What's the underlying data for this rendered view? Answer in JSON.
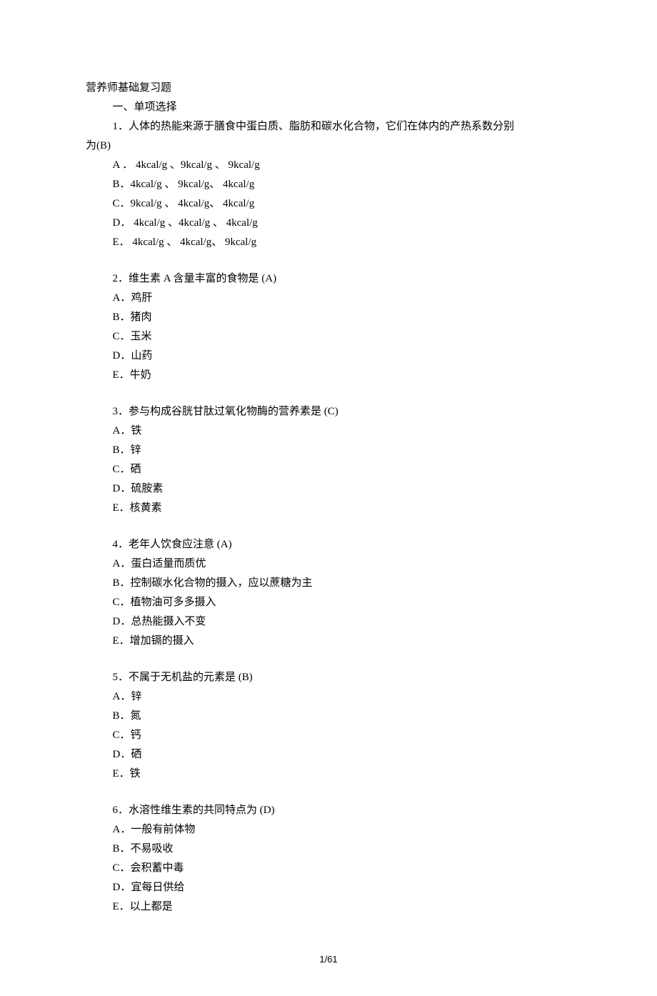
{
  "title": "营养师基础复习题",
  "section": "一、单项选择",
  "q1": {
    "stem1": "1．人体的热能来源于膳食中蛋白质、脂肪和碳水化合物，它们在体内的产热系数分别",
    "stem2wrap": "为(B)",
    "A": "A ． 4kcal/g 、9kcal/g 、 9kcal/g",
    "B": "B．4kcal/g 、 9kcal/g、 4kcal/g",
    "C": "C．9kcal/g 、 4kcal/g、 4kcal/g",
    "D": "D． 4kcal/g 、4kcal/g 、 4kcal/g",
    "E": "E． 4kcal/g 、 4kcal/g、 9kcal/g"
  },
  "q2": {
    "stem": "2．维生素  A 含量丰富的食物是    (A)",
    "A": "A．鸡肝",
    "B": "B．猪肉",
    "C": "C．玉米",
    "D": "D．山药",
    "E": "E．牛奶"
  },
  "q3": {
    "stem": "3．参与构成谷胱甘肽过氧化物酶的营养素是      (C)",
    "A": "A．铁",
    "B": "B．锌",
    "C": "C．硒",
    "D": "D．硫胺素",
    "E": "E．核黄素"
  },
  "q4": {
    "stem": "4．老年人饮食应注意   (A)",
    "A": "A．蛋白适量而质优",
    "B": "B．控制碳水化合物的摄入，应以蔗糖为主",
    "C": "C．植物油可多多摄入",
    "D": "D．总热能摄入不变",
    "E": "E．增加镉的摄入"
  },
  "q5": {
    "stem": "5．不属于无机盐的元素是    (B)",
    "A": "A．锌",
    "B": "B．氮",
    "C": "C．钙",
    "D": "D．硒",
    "E": "E．铁"
  },
  "q6": {
    "stem": "6．水溶性维生素的共同特点为     (D)",
    "A": "A．一般有前体物",
    "B": "B．不易吸收",
    "C": "C．会积蓄中毒",
    "D": "D．宜每日供给",
    "E": "E．以上都是"
  },
  "footer": "1/61"
}
